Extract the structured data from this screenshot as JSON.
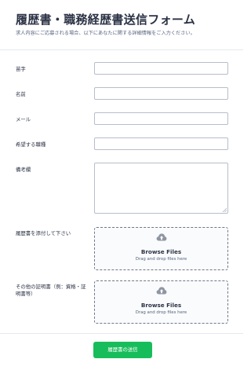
{
  "header": {
    "title": "履歴書・職務経歴書送信フォーム",
    "subtitle": "求人内容にご応募される場合、以下にあなたに関する詳細情報をご入力ください。"
  },
  "fields": {
    "surname_label": "苗字",
    "name_label": "名前",
    "email_label": "メール",
    "desired_job_label": "希望する職種",
    "remarks_label": "備考欄",
    "resume_label": "履歴書を添付して下さい",
    "certificates_label": "その他の証明書（例：資格・証明書等）"
  },
  "upload": {
    "browse_label": "Browse Files",
    "drag_label": "Drag and drop files here",
    "icon": "cloud-upload-icon"
  },
  "submit": {
    "label": "履歴書の送信"
  },
  "colors": {
    "accent": "#18bd5b",
    "text": "#2c3345",
    "border": "#b8bdc9"
  }
}
